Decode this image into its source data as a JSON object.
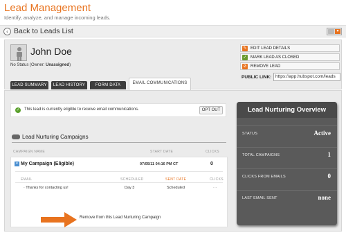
{
  "header": {
    "title": "Lead Management",
    "subtitle": "Identify, analyze, and manage incoming leads."
  },
  "backbar": {
    "back_label": "Back to Leads List"
  },
  "lead": {
    "name": "John Doe",
    "status_label": "No Status",
    "owner_prefix": "(Owner: ",
    "owner_value": "Unassigned",
    "owner_suffix": ")"
  },
  "tabs": [
    {
      "label": "LEAD SUMMARY",
      "active": false
    },
    {
      "label": "LEAD HISTORY",
      "active": false
    },
    {
      "label": "FORM DATA",
      "active": false
    },
    {
      "label": "EMAIL COMMUNICATIONS",
      "active": true
    }
  ],
  "actions": {
    "edit": "EDIT LEAD DETAILS",
    "close": "MARK LEAD AS CLOSED",
    "remove": "REMOVE LEAD",
    "public_link_label": "PUBLIC LINK:",
    "public_link_value": "https://app.hubspot.com/leads"
  },
  "eligibility": {
    "message": "This lead is currently eligible to receive email communications.",
    "optout_label": "OPT OUT"
  },
  "campaigns": {
    "heading": "Lead Nurturing Campaigns",
    "columns": {
      "name": "CAMPAIGN NAME",
      "start": "START DATE",
      "clicks": "CLICKS"
    },
    "items": [
      {
        "name": "My Campaign (Eligible)",
        "start": "07/05/11 04:16 PM CT",
        "clicks": "0",
        "email_columns": {
          "email": "EMAIL",
          "scheduled": "SCHEDULED",
          "sent": "SENT DATE",
          "clicks": "CLICKS"
        },
        "emails": [
          {
            "name": "Thanks for contacting us!",
            "scheduled": "Day 3",
            "sent": "Scheduled",
            "clicks": "- -"
          }
        ]
      }
    ],
    "remove_label": "Remove from this Lead Nurturing Campaign"
  },
  "overview": {
    "title": "Lead Nurturing Overview",
    "rows": [
      {
        "label": "STATUS",
        "value": "Active"
      },
      {
        "label": "TOTAL CAMPAIGNS",
        "value": "1"
      },
      {
        "label": "CLICKS FROM EMAILS",
        "value": "0"
      },
      {
        "label": "LAST EMAIL SENT",
        "value": "none"
      }
    ]
  },
  "colors": {
    "accent": "#e8731f",
    "dark_panel": "#5a5a5a",
    "success": "#5aa02c"
  }
}
